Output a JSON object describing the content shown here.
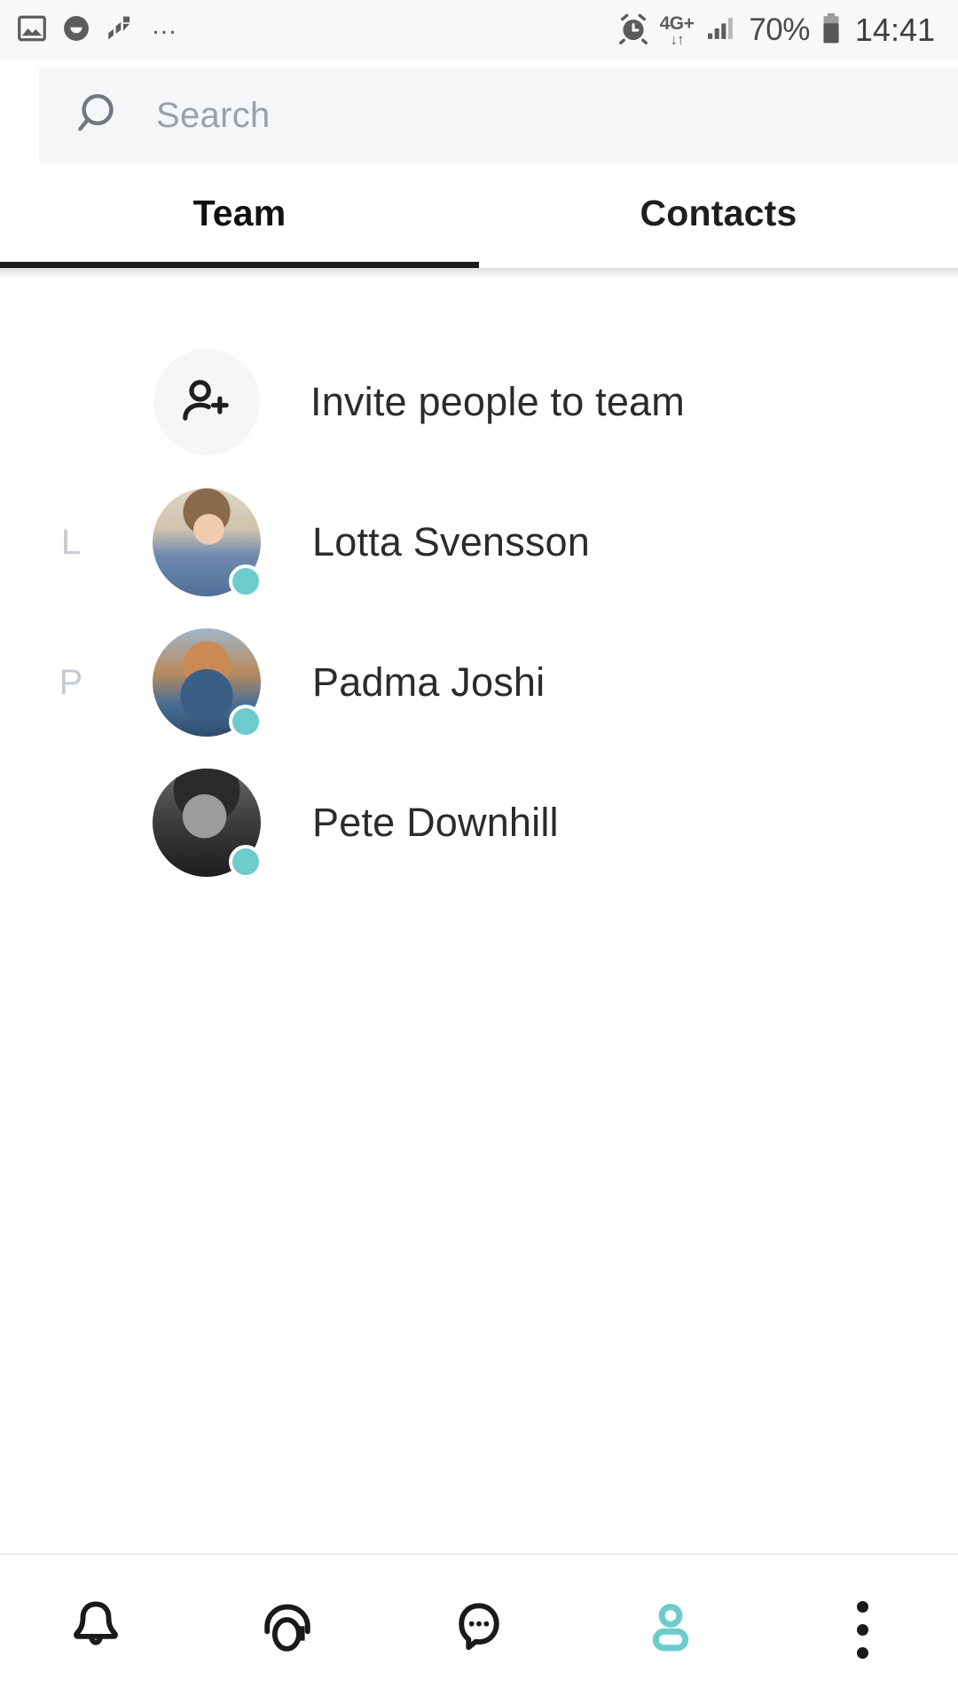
{
  "status_bar": {
    "left_icons": [
      {
        "name": "image-icon",
        "label": "image"
      },
      {
        "name": "smiley-icon",
        "label": "smiley"
      },
      {
        "name": "jira-icon",
        "label": "jira"
      }
    ],
    "overflow": "…",
    "alarm_icon": "alarm-clock-icon",
    "network_label": "4G+",
    "network_arrows": "↓↑",
    "signal_icon": "signal-bars-icon",
    "battery_percent": "70%",
    "battery_icon": "battery-icon",
    "time": "14:41"
  },
  "search": {
    "placeholder": "Search",
    "value": "",
    "icon": "search-icon"
  },
  "tabs": {
    "items": [
      {
        "label": "Team",
        "active": true
      },
      {
        "label": "Contacts",
        "active": false
      }
    ]
  },
  "list": {
    "invite": {
      "label": "Invite people to team",
      "icon": "add-person-icon"
    },
    "contacts": [
      {
        "initial": "L",
        "name": "Lotta Svensson",
        "avatar": "photo-lotta",
        "status": "online"
      },
      {
        "initial": "P",
        "name": "Padma Joshi",
        "avatar": "photo-padma",
        "status": "online"
      },
      {
        "initial": "",
        "name": "Pete Downhill",
        "avatar": "photo-pete",
        "status": "online"
      }
    ]
  },
  "bottom_nav": {
    "items": [
      {
        "name": "notifications",
        "icon": "bell-icon",
        "active": false
      },
      {
        "name": "support",
        "icon": "headset-icon",
        "active": false
      },
      {
        "name": "messages",
        "icon": "chat-bubble-icon",
        "active": false
      },
      {
        "name": "profile",
        "icon": "person-icon",
        "active": true
      },
      {
        "name": "more",
        "icon": "kebab-menu-icon",
        "active": false
      }
    ]
  },
  "colors": {
    "accent": "#6ecbcb",
    "text_primary": "#2b2b2b",
    "text_muted": "#9aa1a9",
    "search_bg": "#f4f6f8",
    "status_bar_bg": "#f7f8f9"
  }
}
